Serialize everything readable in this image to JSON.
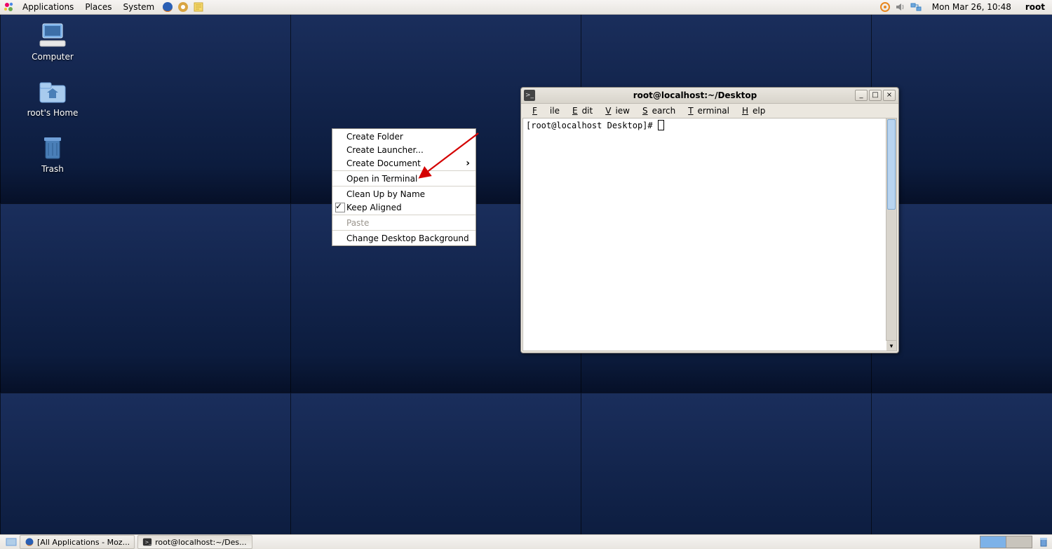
{
  "top_panel": {
    "menus": {
      "applications": "Applications",
      "places": "Places",
      "system": "System"
    },
    "clock": "Mon Mar 26, 10:48",
    "user": "root"
  },
  "desktop_icons": {
    "computer": "Computer",
    "home": "root's Home",
    "trash": "Trash"
  },
  "context_menu": {
    "create_folder": "Create Folder",
    "create_launcher": "Create Launcher...",
    "create_document": "Create Document",
    "open_terminal": "Open in Terminal",
    "clean_up": "Clean Up by Name",
    "keep_aligned": "Keep Aligned",
    "paste": "Paste",
    "change_bg": "Change Desktop Background"
  },
  "terminal": {
    "title": "root@localhost:~/Desktop",
    "menubar": {
      "file": "File",
      "edit": "Edit",
      "view": "View",
      "search": "Search",
      "terminal": "Terminal",
      "help": "Help"
    },
    "prompt": "[root@localhost Desktop]# "
  },
  "taskbar": {
    "btn1": "[All Applications - Moz...",
    "btn2": "root@localhost:~/Des..."
  }
}
